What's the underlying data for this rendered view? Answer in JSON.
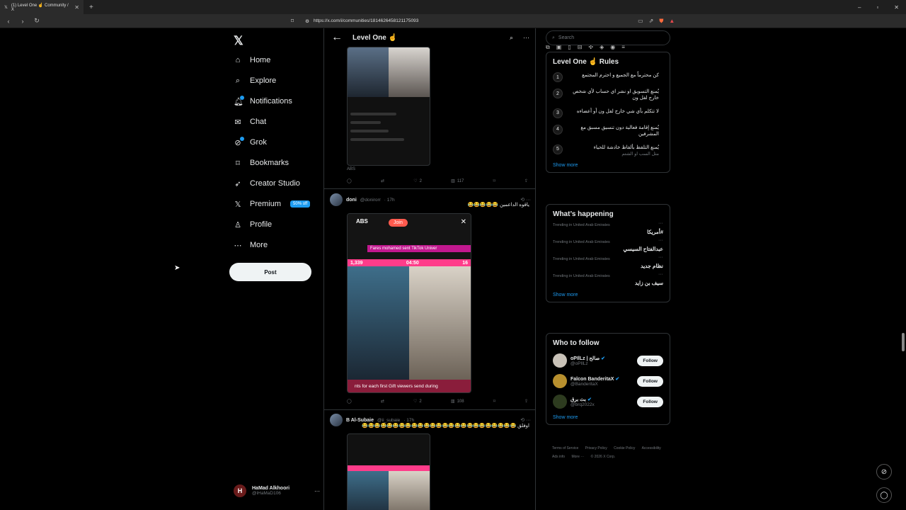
{
  "browser": {
    "tab_title": "(1) Level One ☝ Community / X",
    "new_tab": "+",
    "url": "https://x.com/i/communities/1814626458121175093",
    "window_controls": [
      "–",
      "▫",
      "✕"
    ]
  },
  "nav": {
    "logo": "𝕏",
    "items": [
      {
        "label": "Home",
        "icon": "home-icon",
        "glyph": "⌂"
      },
      {
        "label": "Explore",
        "icon": "search-icon",
        "glyph": "⌕"
      },
      {
        "label": "Notifications",
        "icon": "bell-icon",
        "glyph": "♫"
      },
      {
        "label": "Chat",
        "icon": "mail-icon",
        "glyph": "✉"
      },
      {
        "label": "Grok",
        "icon": "grok-icon",
        "glyph": "⊘"
      },
      {
        "label": "Bookmarks",
        "icon": "bookmark-icon",
        "glyph": "⌑"
      },
      {
        "label": "Creator Studio",
        "icon": "rocket-icon",
        "glyph": "➶"
      },
      {
        "label": "Premium",
        "icon": "x-icon",
        "glyph": "𝕏"
      },
      {
        "label": "Profile",
        "icon": "person-icon",
        "glyph": "♙"
      },
      {
        "label": "More",
        "icon": "more-circle-icon",
        "glyph": "⋯"
      }
    ],
    "premium_badge": "50% off",
    "post_label": "Post",
    "account": {
      "initial": "H",
      "name": "HaMad Alkhoori",
      "handle": "@iHaMaD106",
      "more": "···"
    }
  },
  "main": {
    "title": "Level One ☝",
    "back": "←",
    "header_search": "⌕",
    "header_more": "···",
    "post1": {
      "caption": "ABS",
      "replies": "",
      "reposts": "",
      "likes": "2",
      "views": "117"
    },
    "post2": {
      "name": "doni",
      "handle": "@donirorr",
      "time": "· 17h",
      "text": "ياقوه الداعمين 😂😂😂😂😂",
      "live_name": "ABS",
      "live_join": "Join",
      "live_banner": "Fares mohamed sent TikTok Univer",
      "live_left": "1,339",
      "live_timer": "04:50",
      "live_right": "16",
      "live_footer": "nts for each first Gift viewers send during",
      "likes": "2",
      "views": "108"
    },
    "post3": {
      "name": "B Al-Subaie",
      "handle": "@ii_subaie",
      "time": "· 17h",
      "text": "اوفلق 😂😂😂😂😂😂😂😂😂😂😂😂😂😂😂😂😂😂😂😂😂😂😂😂😂"
    }
  },
  "right": {
    "search_placeholder": "Search",
    "rules_title": "Level One ☝ Rules",
    "rules": [
      {
        "num": "1",
        "text": "كن محترماً مع الجميع و احترم المجتمع",
        "sub": ""
      },
      {
        "num": "2",
        "text": "يُمنع التسويق او نشر اي حساب لأي شخص خارج لفل ون",
        "sub": ""
      },
      {
        "num": "3",
        "text": "لا تتكلم بأي شي خارج لفل ون أو أعضاءه",
        "sub": ""
      },
      {
        "num": "4",
        "text": "يُمنع إقامة فعالية دون تنسيق مسبق مع المشرفين",
        "sub": ""
      },
      {
        "num": "5",
        "text": "يُمنع التلفظ بألفاظ خادشة للحياء",
        "sub": "مثل السب او الشتم"
      }
    ],
    "show_more": "Show more",
    "happening_title": "What’s happening",
    "trends": [
      {
        "meta": "Trending in United Arab Emirates",
        "name": "#أمريكا"
      },
      {
        "meta": "Trending in United Arab Emirates",
        "name": "عبدالفتاح السيسي"
      },
      {
        "meta": "Trending in United Arab Emirates",
        "name": "نظام جديد"
      },
      {
        "meta": "Trending in United Arab Emirates",
        "name": "سيف بن زايد"
      }
    ],
    "wtf_title": "Who to follow",
    "follow_label": "Follow",
    "who_to_follow": [
      {
        "name": "oPIlLz | صالح",
        "handle": "@oPIlLz",
        "color": "#c9c2b8"
      },
      {
        "name": "Falcon BanderitaX",
        "handle": "@BanderitaX",
        "color": "#b8902e"
      },
      {
        "name": "بث برق",
        "handle": "@brq2022x",
        "color": "#2d3b1f"
      }
    ],
    "footer": [
      "Terms of Service",
      "Privacy Policy",
      "Cookie Policy",
      "Accessibility",
      "Ads info",
      "More ···",
      "© 2026 X Corp."
    ]
  },
  "colors": {
    "accent": "#1d9bf0",
    "background": "#000000",
    "border": "#2f3336"
  }
}
